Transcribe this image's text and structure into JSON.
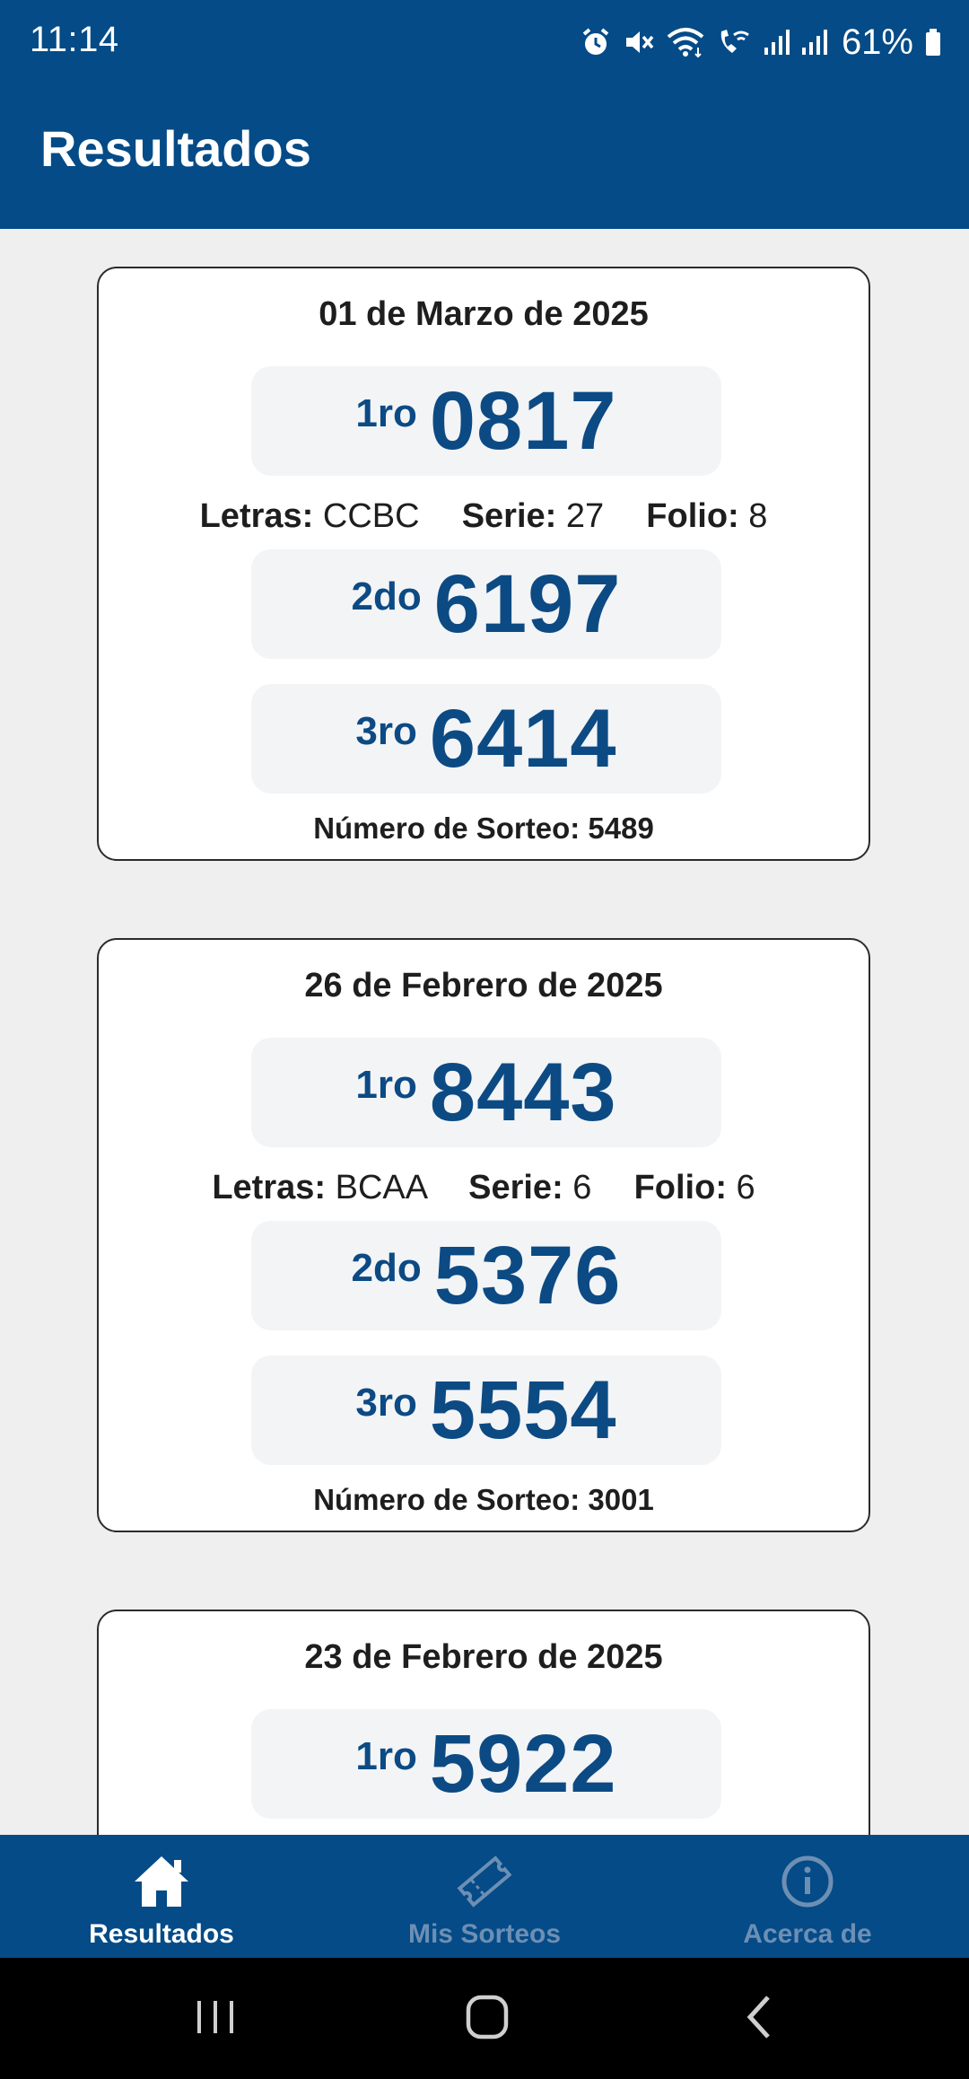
{
  "status_bar": {
    "time": "11:14",
    "battery": "61%",
    "icons": [
      "alarm-icon",
      "mute-icon",
      "wifi-icon",
      "wifi-calling-icon",
      "signal-icon",
      "signal-icon",
      "battery-icon"
    ]
  },
  "header": {
    "title": "Resultados"
  },
  "results": [
    {
      "date": "01 de Marzo de 2025",
      "first": {
        "place": "1ro",
        "number": "0817"
      },
      "letras_label": "Letras:",
      "letras": "CCBC",
      "serie_label": "Serie:",
      "serie": "27",
      "folio_label": "Folio:",
      "folio": "8",
      "second": {
        "place": "2do",
        "number": "6197"
      },
      "third": {
        "place": "3ro",
        "number": "6414"
      },
      "sorteo": "Número de Sorteo: 5489"
    },
    {
      "date": "26 de Febrero de 2025",
      "first": {
        "place": "1ro",
        "number": "8443"
      },
      "letras_label": "Letras:",
      "letras": "BCAA",
      "serie_label": "Serie:",
      "serie": "6",
      "folio_label": "Folio:",
      "folio": "6",
      "second": {
        "place": "2do",
        "number": "5376"
      },
      "third": {
        "place": "3ro",
        "number": "5554"
      },
      "sorteo": "Número de Sorteo: 3001"
    },
    {
      "date": "23 de Febrero de 2025",
      "first": {
        "place": "1ro",
        "number": "5922"
      }
    }
  ],
  "bottom_nav": {
    "items": [
      {
        "label": "Resultados",
        "icon": "home-icon",
        "active": true
      },
      {
        "label": "Mis Sorteos",
        "icon": "ticket-icon",
        "active": false
      },
      {
        "label": "Acerca de",
        "icon": "info-icon",
        "active": false
      }
    ]
  },
  "system_nav": [
    "recents-icon",
    "home-button-icon",
    "back-icon"
  ],
  "colors": {
    "primary": "#044b87",
    "number": "#0c4a84",
    "background": "#efefef",
    "inactive_nav": "#6d8fb4"
  }
}
